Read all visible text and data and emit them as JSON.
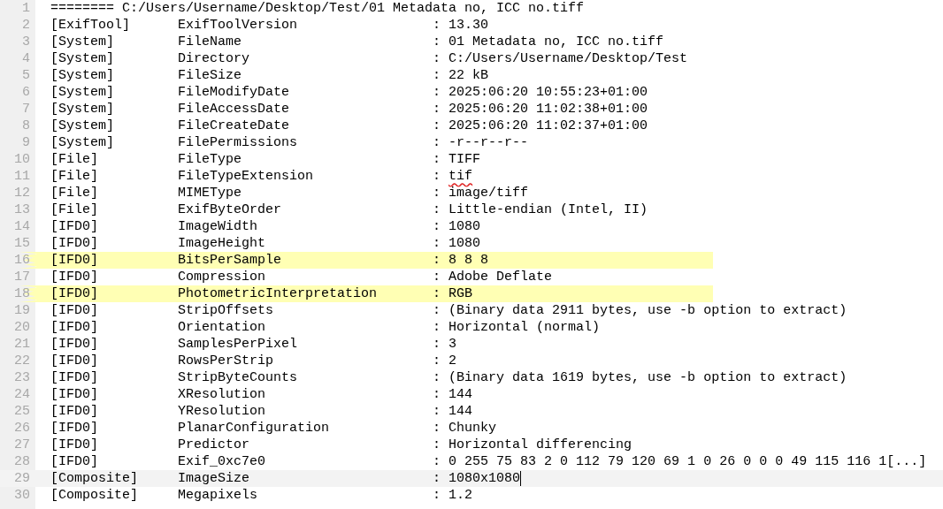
{
  "editor": {
    "lines": [
      {
        "kind": "header",
        "number": "1",
        "text": "======== C:/Users/Username/Desktop/Test/01 Metadata no, ICC no.tiff",
        "highlighted": false,
        "current": false
      },
      {
        "kind": "entry",
        "number": "2",
        "group": "[ExifTool]",
        "tag": "ExifToolVersion",
        "sep": ":",
        "value": "13.30",
        "highlighted": false,
        "current": false,
        "misspelled": false
      },
      {
        "kind": "entry",
        "number": "3",
        "group": "[System]",
        "tag": "FileName",
        "sep": ":",
        "value": "01 Metadata no, ICC no.tiff",
        "highlighted": false,
        "current": false,
        "misspelled": false
      },
      {
        "kind": "entry",
        "number": "4",
        "group": "[System]",
        "tag": "Directory",
        "sep": ":",
        "value": "C:/Users/Username/Desktop/Test",
        "highlighted": false,
        "current": false,
        "misspelled": false
      },
      {
        "kind": "entry",
        "number": "5",
        "group": "[System]",
        "tag": "FileSize",
        "sep": ":",
        "value": "22 kB",
        "highlighted": false,
        "current": false,
        "misspelled": false
      },
      {
        "kind": "entry",
        "number": "6",
        "group": "[System]",
        "tag": "FileModifyDate",
        "sep": ":",
        "value": "2025:06:20 10:55:23+01:00",
        "highlighted": false,
        "current": false,
        "misspelled": false
      },
      {
        "kind": "entry",
        "number": "7",
        "group": "[System]",
        "tag": "FileAccessDate",
        "sep": ":",
        "value": "2025:06:20 11:02:38+01:00",
        "highlighted": false,
        "current": false,
        "misspelled": false
      },
      {
        "kind": "entry",
        "number": "8",
        "group": "[System]",
        "tag": "FileCreateDate",
        "sep": ":",
        "value": "2025:06:20 11:02:37+01:00",
        "highlighted": false,
        "current": false,
        "misspelled": false
      },
      {
        "kind": "entry",
        "number": "9",
        "group": "[System]",
        "tag": "FilePermissions",
        "sep": ":",
        "value": "-r--r--r--",
        "highlighted": false,
        "current": false,
        "misspelled": false
      },
      {
        "kind": "entry",
        "number": "10",
        "group": "[File]",
        "tag": "FileType",
        "sep": ":",
        "value": "TIFF",
        "highlighted": false,
        "current": false,
        "misspelled": false
      },
      {
        "kind": "entry",
        "number": "11",
        "group": "[File]",
        "tag": "FileTypeExtension",
        "sep": ":",
        "value": "tif",
        "highlighted": false,
        "current": false,
        "misspelled": true
      },
      {
        "kind": "entry",
        "number": "12",
        "group": "[File]",
        "tag": "MIMEType",
        "sep": ":",
        "value": "image/tiff",
        "highlighted": false,
        "current": false,
        "misspelled": false
      },
      {
        "kind": "entry",
        "number": "13",
        "group": "[File]",
        "tag": "ExifByteOrder",
        "sep": ":",
        "value": "Little-endian (Intel, II)",
        "highlighted": false,
        "current": false,
        "misspelled": false
      },
      {
        "kind": "entry",
        "number": "14",
        "group": "[IFD0]",
        "tag": "ImageWidth",
        "sep": ":",
        "value": "1080",
        "highlighted": false,
        "current": false,
        "misspelled": false
      },
      {
        "kind": "entry",
        "number": "15",
        "group": "[IFD0]",
        "tag": "ImageHeight",
        "sep": ":",
        "value": "1080",
        "highlighted": false,
        "current": false,
        "misspelled": false
      },
      {
        "kind": "entry",
        "number": "16",
        "group": "[IFD0]",
        "tag": "BitsPerSample",
        "sep": ":",
        "value": "8 8 8",
        "highlighted": true,
        "current": false,
        "misspelled": false
      },
      {
        "kind": "entry",
        "number": "17",
        "group": "[IFD0]",
        "tag": "Compression",
        "sep": ":",
        "value": "Adobe Deflate",
        "highlighted": false,
        "current": false,
        "misspelled": false
      },
      {
        "kind": "entry",
        "number": "18",
        "group": "[IFD0]",
        "tag": "PhotometricInterpretation",
        "sep": ":",
        "value": "RGB",
        "highlighted": true,
        "current": false,
        "misspelled": false
      },
      {
        "kind": "entry",
        "number": "19",
        "group": "[IFD0]",
        "tag": "StripOffsets",
        "sep": ":",
        "value": "(Binary data 2911 bytes, use -b option to extract)",
        "highlighted": false,
        "current": false,
        "misspelled": false
      },
      {
        "kind": "entry",
        "number": "20",
        "group": "[IFD0]",
        "tag": "Orientation",
        "sep": ":",
        "value": "Horizontal (normal)",
        "highlighted": false,
        "current": false,
        "misspelled": false
      },
      {
        "kind": "entry",
        "number": "21",
        "group": "[IFD0]",
        "tag": "SamplesPerPixel",
        "sep": ":",
        "value": "3",
        "highlighted": false,
        "current": false,
        "misspelled": false
      },
      {
        "kind": "entry",
        "number": "22",
        "group": "[IFD0]",
        "tag": "RowsPerStrip",
        "sep": ":",
        "value": "2",
        "highlighted": false,
        "current": false,
        "misspelled": false
      },
      {
        "kind": "entry",
        "number": "23",
        "group": "[IFD0]",
        "tag": "StripByteCounts",
        "sep": ":",
        "value": "(Binary data 1619 bytes, use -b option to extract)",
        "highlighted": false,
        "current": false,
        "misspelled": false
      },
      {
        "kind": "entry",
        "number": "24",
        "group": "[IFD0]",
        "tag": "XResolution",
        "sep": ":",
        "value": "144",
        "highlighted": false,
        "current": false,
        "misspelled": false
      },
      {
        "kind": "entry",
        "number": "25",
        "group": "[IFD0]",
        "tag": "YResolution",
        "sep": ":",
        "value": "144",
        "highlighted": false,
        "current": false,
        "misspelled": false
      },
      {
        "kind": "entry",
        "number": "26",
        "group": "[IFD0]",
        "tag": "PlanarConfiguration",
        "sep": ":",
        "value": "Chunky",
        "highlighted": false,
        "current": false,
        "misspelled": false
      },
      {
        "kind": "entry",
        "number": "27",
        "group": "[IFD0]",
        "tag": "Predictor",
        "sep": ":",
        "value": "Horizontal differencing",
        "highlighted": false,
        "current": false,
        "misspelled": false
      },
      {
        "kind": "entry",
        "number": "28",
        "group": "[IFD0]",
        "tag": "Exif_0xc7e0",
        "sep": ":",
        "value": "0 255 75 83 2 0 112 79 120 69 1 0 26 0 0 0 49 115 116 1[...]",
        "highlighted": false,
        "current": false,
        "misspelled": false
      },
      {
        "kind": "entry",
        "number": "29",
        "group": "[Composite]",
        "tag": "ImageSize",
        "sep": ":",
        "value": "1080x1080",
        "highlighted": false,
        "current": true,
        "misspelled": false
      },
      {
        "kind": "entry",
        "number": "30",
        "group": "[Composite]",
        "tag": "Megapixels",
        "sep": ":",
        "value": "1.2",
        "highlighted": false,
        "current": false,
        "misspelled": false
      }
    ]
  }
}
